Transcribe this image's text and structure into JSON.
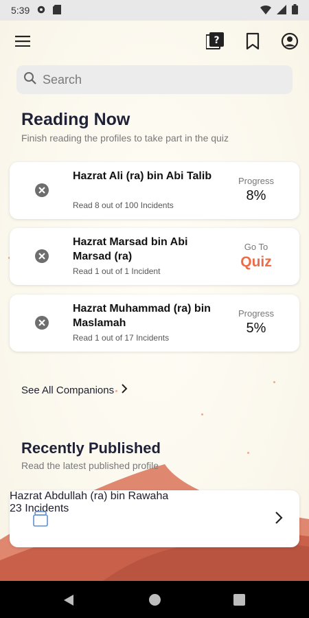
{
  "status_bar": {
    "time": "5:39"
  },
  "search": {
    "placeholder": "Search"
  },
  "reading_now": {
    "title": "Reading Now",
    "subtitle": "Finish reading the profiles to take part in the quiz",
    "items": [
      {
        "name": "Hazrat Ali (ra) bin Abi Talib",
        "meta": "Read 8 out of 100 Incidents",
        "label": "Progress",
        "value": "8%",
        "type": "progress"
      },
      {
        "name": "Hazrat Marsad bin Abi Marsad (ra)",
        "meta": "Read 1 out of 1 Incident",
        "label": "Go To",
        "value": "Quiz",
        "type": "quiz"
      },
      {
        "name": "Hazrat Muhammad (ra) bin Maslamah",
        "meta": "Read 1 out of 17 Incidents",
        "label": "Progress",
        "value": "5%",
        "type": "progress"
      }
    ]
  },
  "see_all": "See All Companions",
  "recently_published": {
    "title": "Recently Published",
    "subtitle": "Read the latest published profile",
    "item": {
      "name": "Hazrat Abdullah (ra) bin Rawaha",
      "meta": "23 Incidents"
    }
  },
  "colors": {
    "accent": "#ee6b47",
    "dune": "#d9705a"
  }
}
